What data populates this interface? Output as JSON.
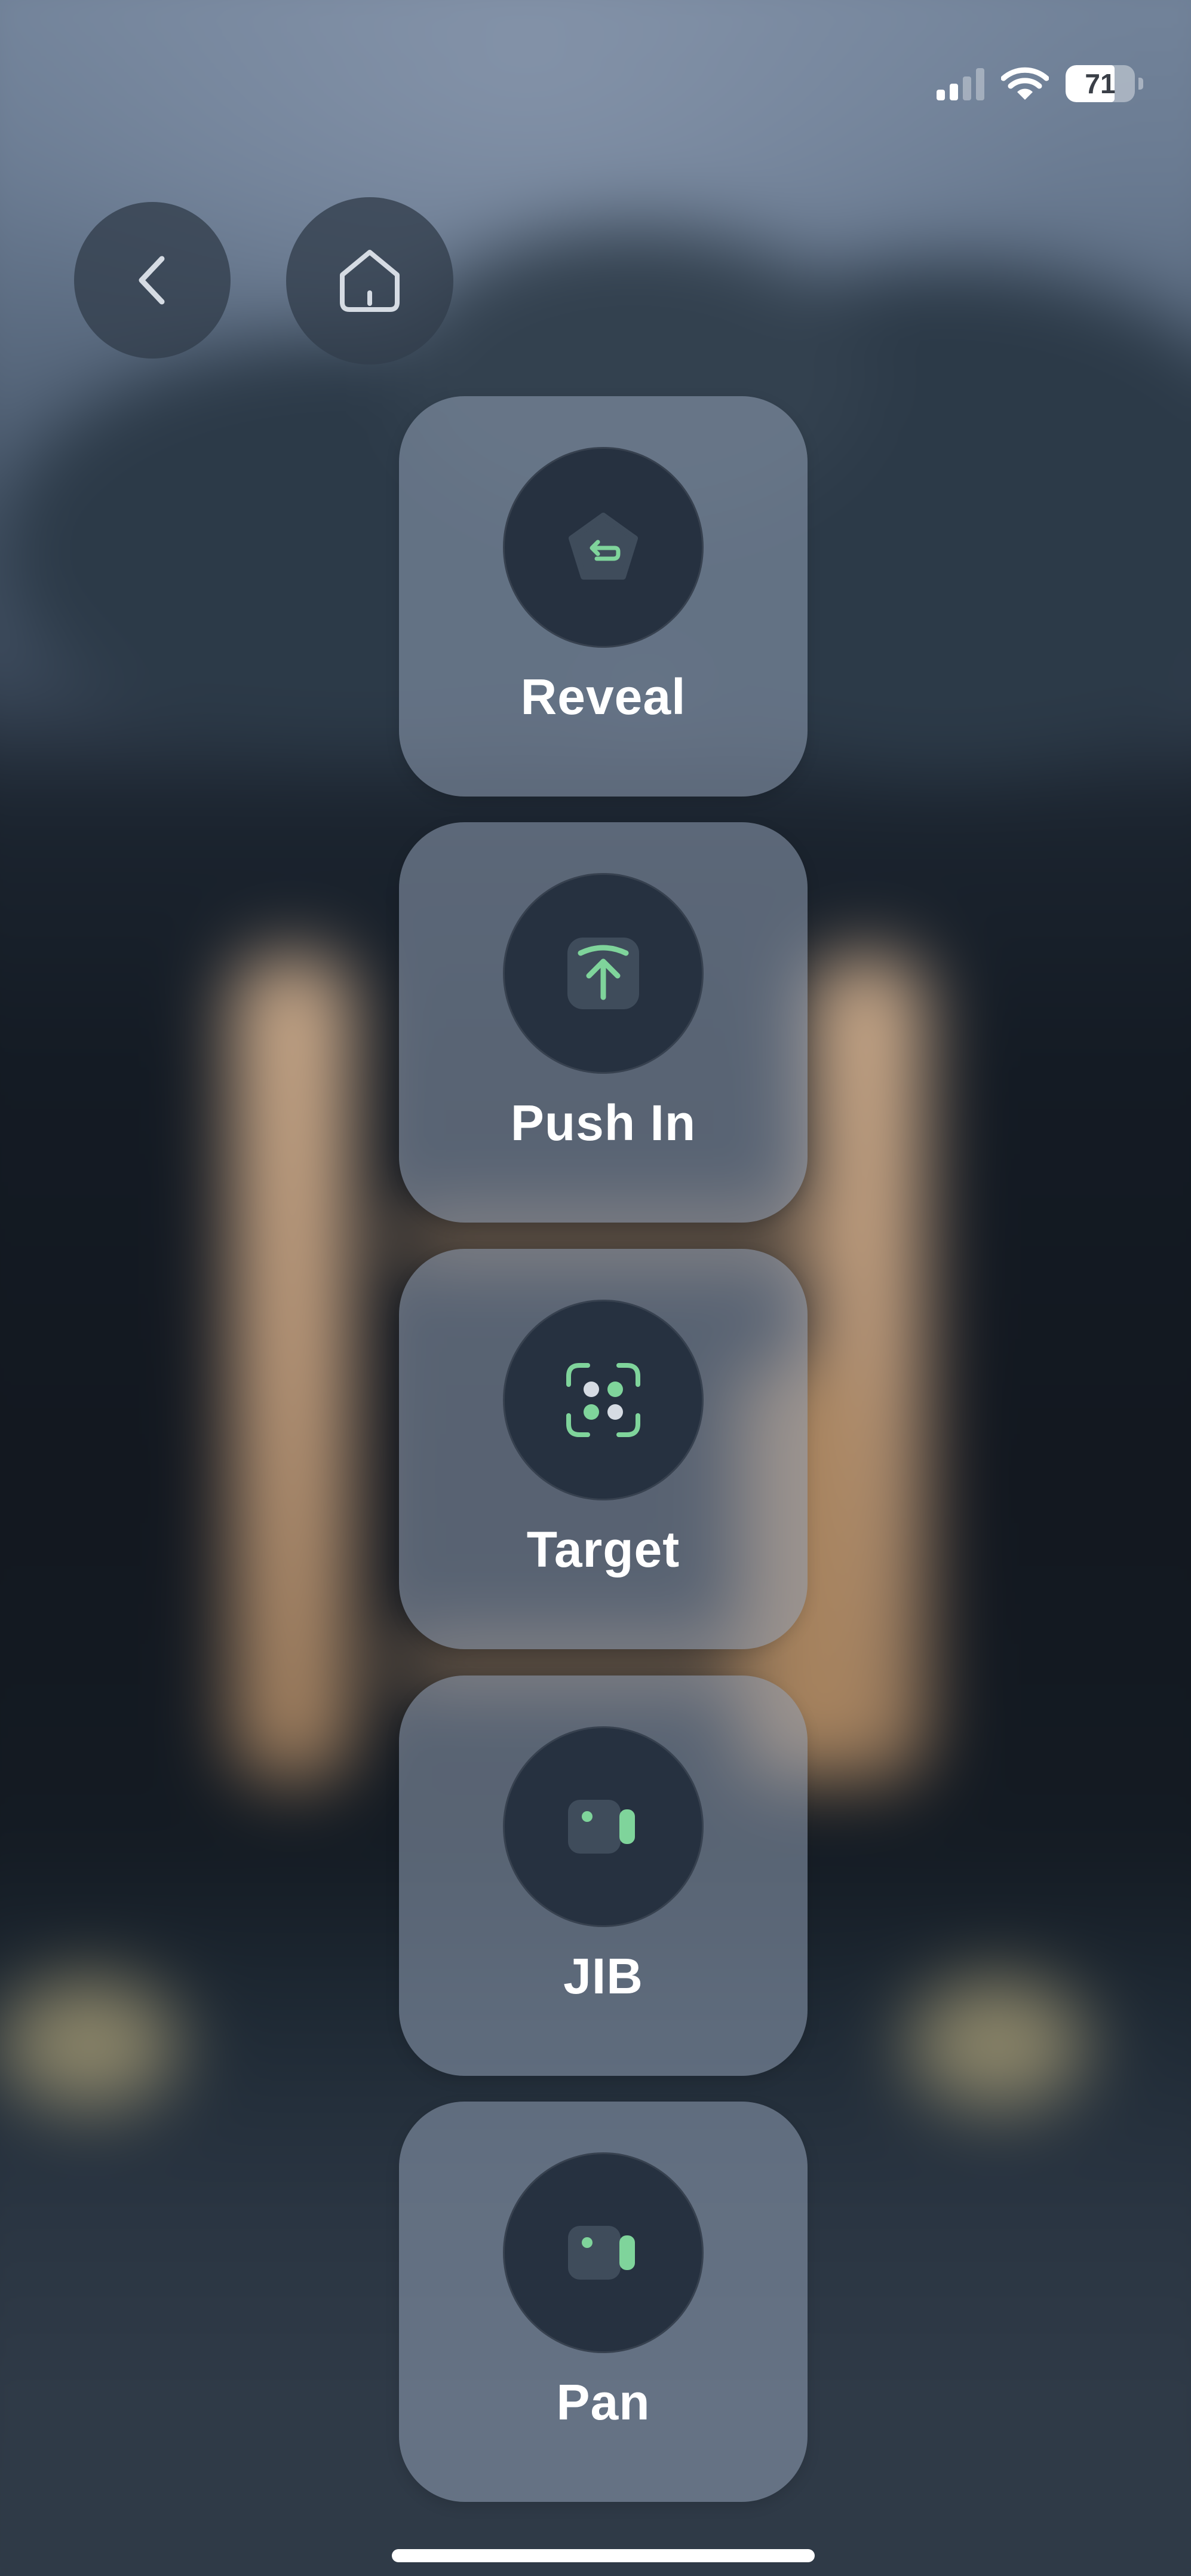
{
  "status_bar": {
    "battery_percent": "71",
    "battery_level": 0.71,
    "signal_bars_active": 2,
    "icons": [
      "cellular-signal-icon",
      "wifi-icon",
      "battery-icon"
    ]
  },
  "nav": {
    "back_icon": "chevron-left-icon",
    "home_icon": "home-icon"
  },
  "actions": [
    {
      "label": "Reveal",
      "icon": "reveal-icon"
    },
    {
      "label": "Push In",
      "icon": "push-in-icon"
    },
    {
      "label": "Target",
      "icon": "target-icon"
    },
    {
      "label": "JIB",
      "icon": "jib-icon"
    },
    {
      "label": "Pan",
      "icon": "pan-icon"
    }
  ],
  "colors": {
    "accent": "#7fd49b",
    "icon_tile": "#3f4c5b",
    "badge": "#263140",
    "text": "#ffffff"
  }
}
